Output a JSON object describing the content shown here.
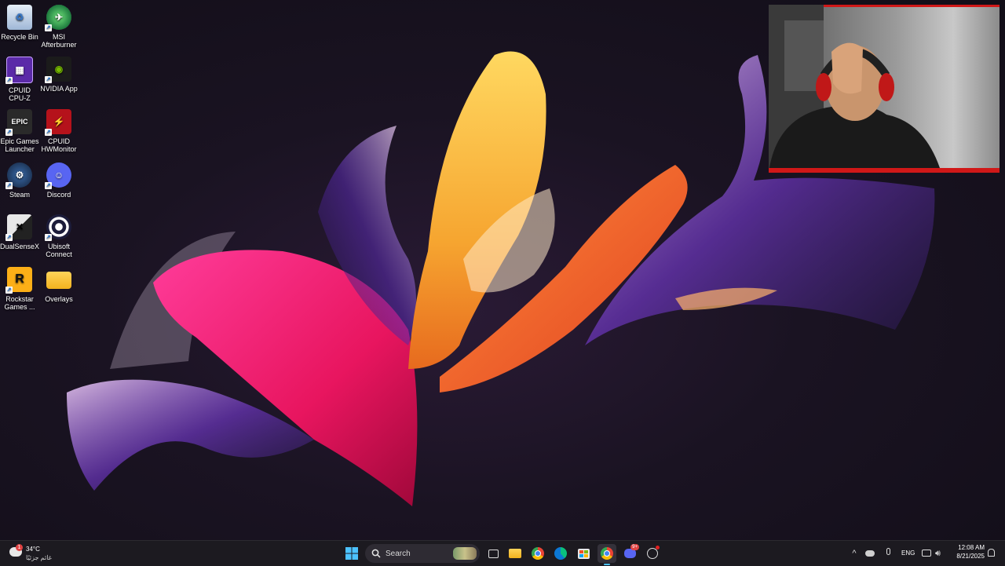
{
  "desktop": {
    "icons": [
      {
        "label": "Recycle Bin"
      },
      {
        "label": "MSI Afterburner"
      },
      {
        "label": "CPUID CPU-Z"
      },
      {
        "label": "NVIDIA App"
      },
      {
        "label": "Epic Games Launcher"
      },
      {
        "label": "CPUID HWMonitor"
      },
      {
        "label": "Steam"
      },
      {
        "label": "Discord"
      },
      {
        "label": "DualSenseX"
      },
      {
        "label": "Ubisoft Connect"
      },
      {
        "label": "Rockstar Games ..."
      },
      {
        "label": "Overlays"
      }
    ]
  },
  "taskbar": {
    "weather": {
      "temp": "34°C",
      "condition": "غائم جزئيًا",
      "badge": "1"
    },
    "search_label": "Search",
    "pinned": [
      "start",
      "search",
      "task-view",
      "file-explorer",
      "chrome",
      "edge",
      "microsoft-store",
      "chrome-profile",
      "discord",
      "obs"
    ],
    "discord_badge": "9+",
    "tray": {
      "language": "ENG",
      "time": "12:08 AM",
      "date": "8/21/2025"
    }
  },
  "colors": {
    "taskbar_bg": "#1c1a20",
    "accent": "#0078d4",
    "webcam_frame": "#d01818"
  }
}
